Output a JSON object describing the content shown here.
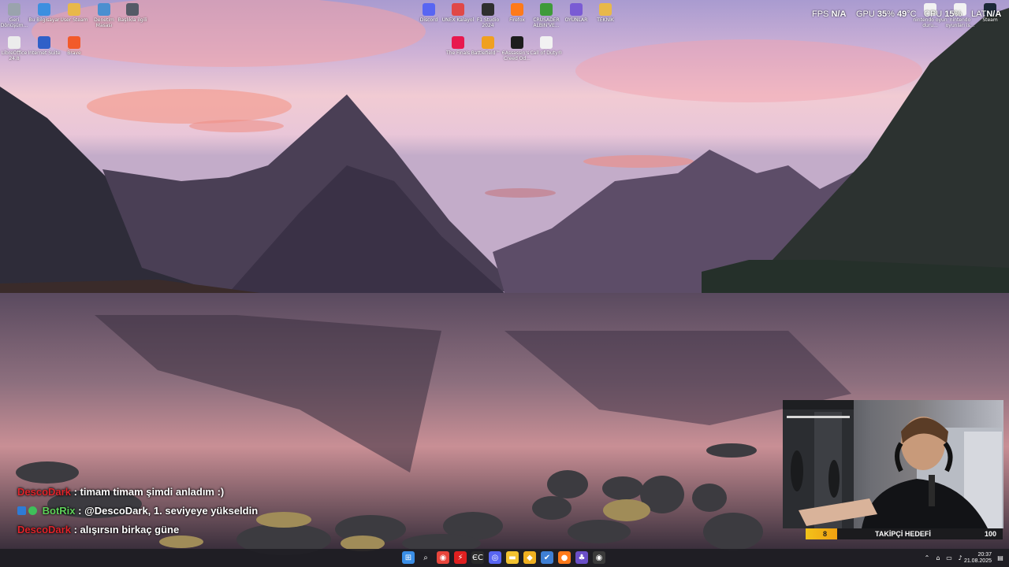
{
  "desktop_icons_left": [
    {
      "label": "Geri Dönüşüm...",
      "icon": "recycle-bin-icon",
      "color": "#9aa3ad"
    },
    {
      "label": "Bu Bilgisayar",
      "icon": "computer-icon",
      "color": "#3c8fe0"
    },
    {
      "label": "User Steam",
      "icon": "folder-icon",
      "color": "#e8b84a"
    },
    {
      "label": "Denetim Masası",
      "icon": "control-panel-icon",
      "color": "#4a8fd0"
    },
    {
      "label": "Başlıkla ilgili",
      "icon": "file-icon",
      "color": "#555a66"
    },
    {
      "label": "LibreOffice 24.8",
      "icon": "libreoffice-icon",
      "color": "#ececec"
    },
    {
      "label": "Internet Suite",
      "icon": "shield-app-icon",
      "color": "#2f60c8"
    },
    {
      "label": "Brave",
      "icon": "brave-icon",
      "color": "#f25a2a"
    }
  ],
  "desktop_icons_center": [
    {
      "label": "Discord",
      "icon": "discord-icon",
      "color": "#5865f2"
    },
    {
      "label": "UNEX Kalayol",
      "icon": "x-app-icon",
      "color": "#e04848"
    },
    {
      "label": "F1 Studio 2024",
      "icon": "f1-icon",
      "color": "#2f2f2f"
    },
    {
      "label": "Firefox",
      "icon": "firefox-icon",
      "color": "#ff7a1a"
    },
    {
      "label": "CRUSADER ALBIN'VE...",
      "icon": "tree-icon",
      "color": "#3f9a3a"
    },
    {
      "label": "OYUNLAR",
      "icon": "games-folder-icon",
      "color": "#7a5bd4"
    },
    {
      "label": "TEKNİK",
      "icon": "folder-icon",
      "color": "#e8b84a"
    },
    {
      "label": "The Finals",
      "icon": "finals-icon",
      "color": "#e8184e"
    },
    {
      "label": "Battlefield™ 6",
      "icon": "battlefield-icon",
      "color": "#f0a020"
    },
    {
      "label": "Assassin's Creed Od...",
      "icon": "assassins-icon",
      "color": "#1d1d1d"
    },
    {
      "label": "Call of Duty®",
      "icon": "document-icon",
      "color": "#f2f2f2"
    }
  ],
  "desktop_icons_right": [
    {
      "label": "nintendo oyun duru...",
      "icon": "document-icon",
      "color": "#f2f2f2"
    },
    {
      "label": "nintendo oyunları is...",
      "icon": "document-icon",
      "color": "#f2f2f2"
    },
    {
      "label": "Steam",
      "icon": "steam-icon",
      "color": "#1b2838"
    }
  ],
  "hud": {
    "fps_label": "FPS",
    "fps_value": "N/A",
    "gpu_label": "GPU",
    "gpu_value": "35",
    "gpu_unit": "%",
    "gpu_temp": "49",
    "gpu_temp_unit": "°C",
    "cpu_label": "CPU",
    "cpu_value": "15",
    "cpu_unit": "%",
    "lat_label": "LAT",
    "lat_value": "N/A"
  },
  "chat": [
    {
      "user": "DescoDark",
      "user_color": "#e0242b",
      "badge": null,
      "message": ": timam timam şimdi anladım :)"
    },
    {
      "user": "BotRix",
      "user_color": "#5fd15a",
      "badge": "bot",
      "message": ": @DescoDark, 1. seviyeye yükseldin"
    },
    {
      "user": "DescoDark",
      "user_color": "#e0242b",
      "badge": null,
      "message": ": alışırsın birkaç güne"
    }
  ],
  "follower_goal": {
    "current": "8",
    "title": "TAKİPÇİ HEDEFİ",
    "target": "100",
    "progress": 0.08,
    "color": "#f2c21a"
  },
  "taskbar": {
    "apps": [
      {
        "name": "start-button",
        "glyph": "⊞",
        "color": "#3a8ee6"
      },
      {
        "name": "search-icon",
        "glyph": "⌕",
        "color": "transparent"
      },
      {
        "name": "chrome-icon",
        "glyph": "◉",
        "color": "#e8453c"
      },
      {
        "name": "app-red-icon",
        "glyph": "⚡",
        "color": "#e02020"
      },
      {
        "name": "app-ec-icon",
        "glyph": "ЄC",
        "color": "#2a2a2a"
      },
      {
        "name": "discord-icon",
        "glyph": "◎",
        "color": "#5865f2"
      },
      {
        "name": "file-explorer-icon",
        "glyph": "▬",
        "color": "#f2c230"
      },
      {
        "name": "app-yellow-icon",
        "glyph": "◆",
        "color": "#f0b020"
      },
      {
        "name": "app-check-icon",
        "glyph": "✔",
        "color": "#3f7fd4"
      },
      {
        "name": "firefox-icon",
        "glyph": "●",
        "color": "#ff7a1a"
      },
      {
        "name": "app-purple-icon",
        "glyph": "♣",
        "color": "#6a4fc8"
      },
      {
        "name": "obs-icon",
        "glyph": "◉",
        "color": "#3a3a3a"
      }
    ],
    "clock_time": "20:37",
    "clock_date": "21.08.2025"
  }
}
